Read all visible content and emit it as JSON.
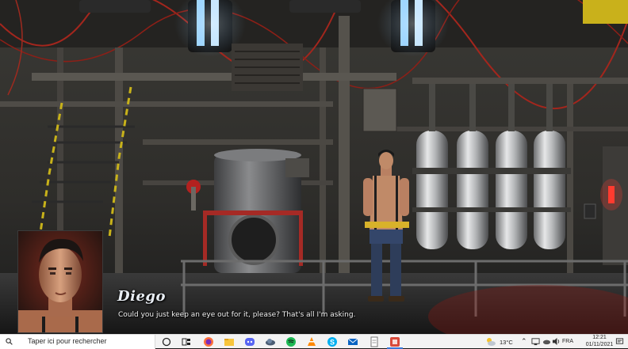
{
  "game": {
    "speaker": "Diego",
    "dialogue": "Could you just keep an eye out for it, please? That's all I'm asking."
  },
  "taskbar": {
    "search_placeholder": "Taper ici pour rechercher",
    "pinned_apps": [
      "task-view-icon",
      "widgets-icon",
      "firefox-icon",
      "file-explorer-icon",
      "discord-icon",
      "cloud-app-icon",
      "spotify-icon",
      "vlc-icon",
      "skype-icon",
      "mail-icon",
      "notepad-icon",
      "game-app-icon"
    ],
    "weather": "13°C",
    "language": "FRA",
    "time": "12:21",
    "date": "01/11/2021"
  },
  "colors": {
    "taskbar_bg": "#f3f3f3",
    "speaker_name": "#e8edf3",
    "dialogue_text": "#f2f2f2"
  }
}
